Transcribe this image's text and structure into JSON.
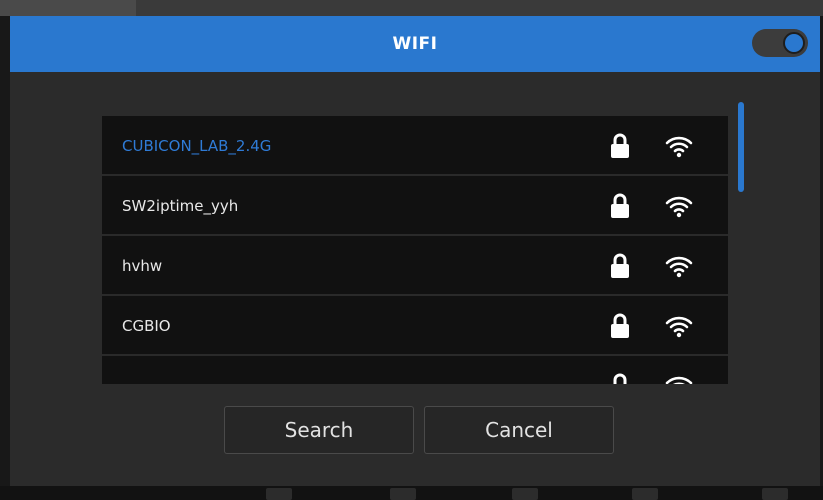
{
  "dialog": {
    "title": "WIFI",
    "toggle_on": true
  },
  "networks": [
    {
      "ssid": "CUBICON_LAB_2.4G",
      "selected": true,
      "locked": true,
      "icon": "wifi-icon"
    },
    {
      "ssid": "SW2iptime_yyh",
      "selected": false,
      "locked": true,
      "icon": "wifi-icon"
    },
    {
      "ssid": "hvhw",
      "selected": false,
      "locked": true,
      "icon": "wifi-icon"
    },
    {
      "ssid": "CGBIO",
      "selected": false,
      "locked": true,
      "icon": "wifi-icon"
    }
  ],
  "buttons": {
    "search_label": "Search",
    "cancel_label": "Cancel"
  },
  "colors": {
    "accent": "#2a78cf",
    "selected_text": "#2f7bd6",
    "list_bg": "#111111",
    "dialog_bg": "#2b2b2b"
  }
}
